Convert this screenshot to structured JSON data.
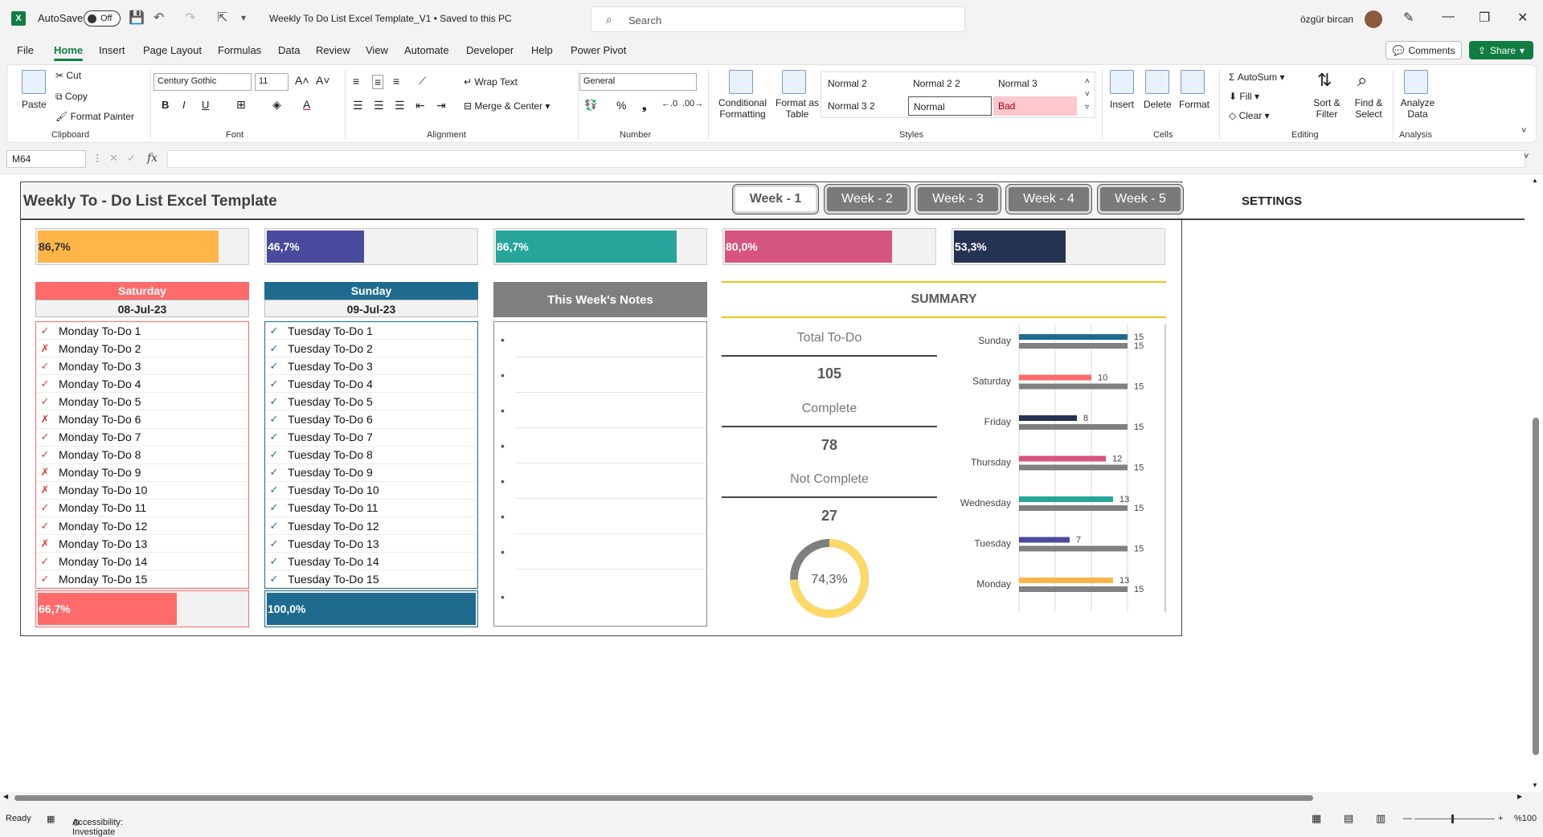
{
  "app": {
    "autosave_label": "AutoSave",
    "autosave_state": "Off",
    "doc_title": "Weekly To Do List Excel Template_V1 • Saved to this PC",
    "search_placeholder": "Search",
    "username": "özgür bircan"
  },
  "menu": [
    "File",
    "Home",
    "Insert",
    "Page Layout",
    "Formulas",
    "Data",
    "Review",
    "View",
    "Automate",
    "Developer",
    "Help",
    "Power Pivot"
  ],
  "menu_active": "Home",
  "comments_label": "Comments",
  "share_label": "Share",
  "ribbon": {
    "paste": "Paste",
    "cut": "Cut",
    "copy": "Copy",
    "format_painter": "Format Painter",
    "clipboard": "Clipboard",
    "font_name": "Century Gothic",
    "font_size": "11",
    "font": "Font",
    "wrap_text": "Wrap Text",
    "merge_center": "Merge & Center",
    "alignment": "Alignment",
    "number_format": "General",
    "number": "Number",
    "conditional_formatting": "Conditional Formatting",
    "format_as_table": "Format as Table",
    "styles_row1": [
      "Normal 2",
      "Normal 2 2",
      "Normal 3"
    ],
    "styles_row2": [
      "Normal 3 2",
      "Normal",
      "Bad"
    ],
    "styles": "Styles",
    "insert": "Insert",
    "delete": "Delete",
    "format": "Format",
    "cells": "Cells",
    "autosum": "AutoSum",
    "fill": "Fill",
    "clear": "Clear",
    "sort_filter": "Sort & Filter",
    "find_select": "Find & Select",
    "editing": "Editing",
    "analyze_data": "Analyze Data",
    "analysis": "Analysis"
  },
  "name_box": "M64",
  "dashboard": {
    "title": "Weekly To - Do List Excel Template",
    "weeks": [
      "Week - 1",
      "Week - 2",
      "Week - 3",
      "Week - 4",
      "Week - 5"
    ],
    "active_week": "Week - 1",
    "settings": "SETTINGS",
    "top_bars": [
      {
        "label": "86,7%",
        "value": 0.867,
        "color": "#ffb547"
      },
      {
        "label": "46,7%",
        "value": 0.467,
        "color": "#4a4a9e"
      },
      {
        "label": "86,7%",
        "value": 0.867,
        "color": "#26a69a"
      },
      {
        "label": "80,0%",
        "value": 0.8,
        "color": "#d6557e"
      },
      {
        "label": "53,3%",
        "value": 0.533,
        "color": "#243352"
      }
    ],
    "saturday": {
      "day": "Saturday",
      "date": "08-Jul-23",
      "color": "#ff6b6b",
      "tasks": [
        {
          "mark": "✓",
          "text": "Monday To-Do 1"
        },
        {
          "mark": "✗",
          "text": "Monday To-Do 2"
        },
        {
          "mark": "✓",
          "text": "Monday To-Do 3"
        },
        {
          "mark": "✓",
          "text": "Monday To-Do 4"
        },
        {
          "mark": "✓",
          "text": "Monday To-Do 5"
        },
        {
          "mark": "✗",
          "text": "Monday To-Do 6"
        },
        {
          "mark": "✓",
          "text": "Monday To-Do 7"
        },
        {
          "mark": "✓",
          "text": "Monday To-Do 8"
        },
        {
          "mark": "✗",
          "text": "Monday To-Do 9"
        },
        {
          "mark": "✗",
          "text": "Monday To-Do 10"
        },
        {
          "mark": "✓",
          "text": "Monday To-Do 11"
        },
        {
          "mark": "✓",
          "text": "Monday To-Do 12"
        },
        {
          "mark": "✗",
          "text": "Monday To-Do 13"
        },
        {
          "mark": "✓",
          "text": "Monday To-Do 14"
        },
        {
          "mark": "✓",
          "text": "Monday To-Do 15"
        }
      ],
      "progress_label": "66,7%",
      "progress": 0.667
    },
    "sunday": {
      "day": "Sunday",
      "date": "09-Jul-23",
      "color": "#1f6b8f",
      "tasks": [
        {
          "mark": "✓",
          "text": "Tuesday To-Do 1"
        },
        {
          "mark": "✓",
          "text": "Tuesday To-Do 2"
        },
        {
          "mark": "✓",
          "text": "Tuesday To-Do 3"
        },
        {
          "mark": "✓",
          "text": "Tuesday To-Do 4"
        },
        {
          "mark": "✓",
          "text": "Tuesday To-Do 5"
        },
        {
          "mark": "✓",
          "text": "Tuesday To-Do 6"
        },
        {
          "mark": "✓",
          "text": "Tuesday To-Do 7"
        },
        {
          "mark": "✓",
          "text": "Tuesday To-Do 8"
        },
        {
          "mark": "✓",
          "text": "Tuesday To-Do 9"
        },
        {
          "mark": "✓",
          "text": "Tuesday To-Do 10"
        },
        {
          "mark": "✓",
          "text": "Tuesday To-Do 11"
        },
        {
          "mark": "✓",
          "text": "Tuesday To-Do 12"
        },
        {
          "mark": "✓",
          "text": "Tuesday To-Do 13"
        },
        {
          "mark": "✓",
          "text": "Tuesday To-Do 14"
        },
        {
          "mark": "✓",
          "text": "Tuesday To-Do 15"
        }
      ],
      "progress_label": "100,0%",
      "progress": 1.0
    },
    "notes_title": "This Week's Notes",
    "summary": {
      "title": "SUMMARY",
      "total_label": "Total To-Do",
      "total": "105",
      "complete_label": "Complete",
      "complete": "78",
      "not_complete_label": "Not Complete",
      "not_complete": "27",
      "donut_label": "74,3%",
      "donut_value": 0.743
    }
  },
  "chart_data": {
    "type": "bar",
    "categories": [
      "Sunday",
      "Saturday",
      "Friday",
      "Thursday",
      "Wednesday",
      "Tuesday",
      "Monday"
    ],
    "series": [
      {
        "values": [
          15,
          10,
          8,
          12,
          13,
          7,
          13
        ],
        "colors": [
          "#1f6b8f",
          "#ff6b6b",
          "#243352",
          "#d6557e",
          "#26a69a",
          "#4a4a9e",
          "#ffb547"
        ]
      },
      {
        "values": [
          15,
          15,
          15,
          15,
          15,
          15,
          15
        ],
        "color": "#808080"
      }
    ],
    "xlim": [
      0,
      15
    ],
    "orientation": "horizontal",
    "grid": true
  },
  "status": {
    "ready": "Ready",
    "accessibility": "Accessibility: Investigate",
    "zoom": "%100"
  }
}
